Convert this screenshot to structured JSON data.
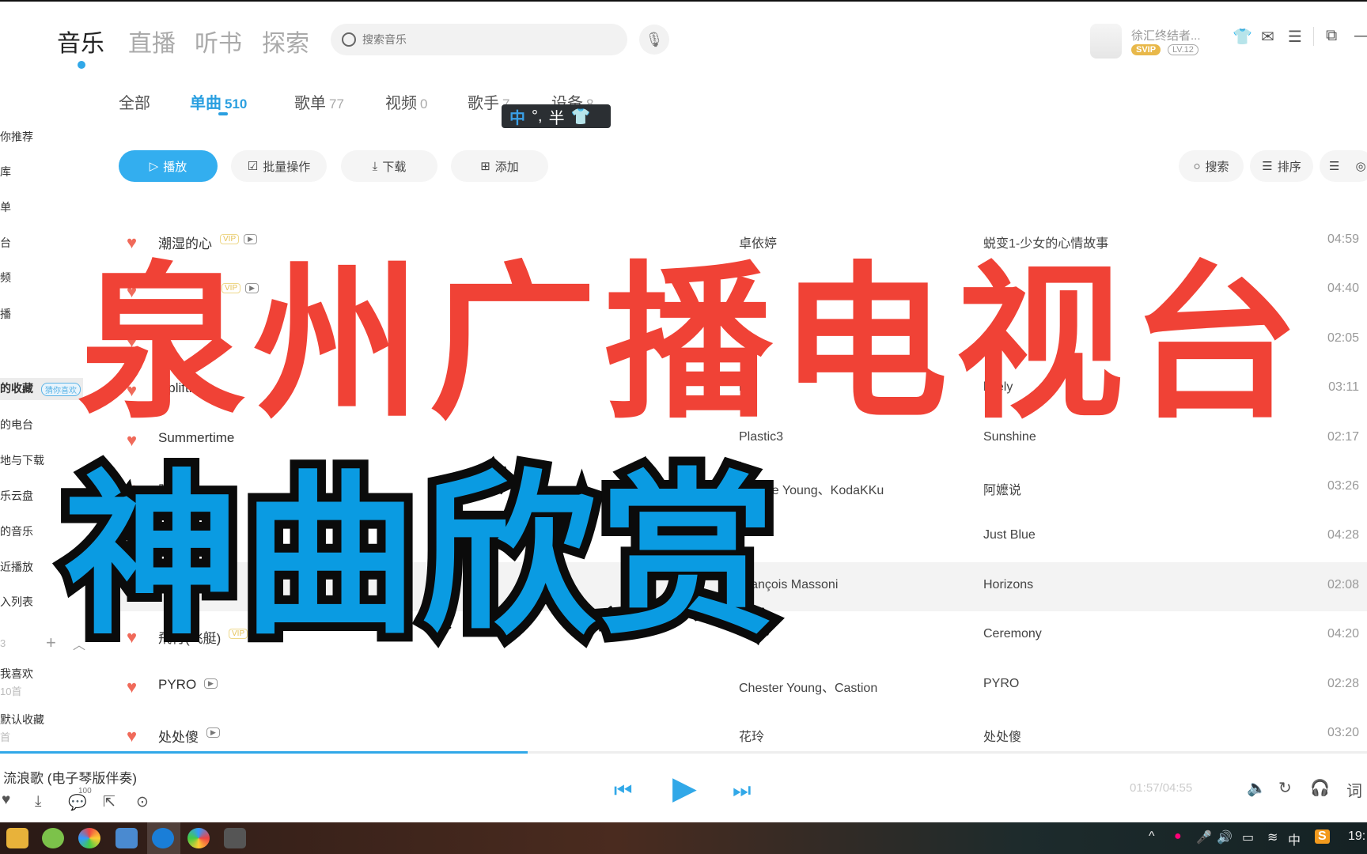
{
  "header": {
    "tabs": [
      "音乐",
      "直播",
      "听书",
      "探索"
    ],
    "active_tab": "音乐",
    "search_placeholder": "搜索音乐",
    "user_name": "徐汇终结者...",
    "svip": "SVIP",
    "level": "LV.12"
  },
  "subtabs": [
    {
      "label": "全部",
      "count": ""
    },
    {
      "label": "单曲",
      "count": "510"
    },
    {
      "label": "歌单",
      "count": "77"
    },
    {
      "label": "视频",
      "count": "0"
    },
    {
      "label": "歌手",
      "count": "7"
    },
    {
      "label": "设备",
      "count": "8"
    }
  ],
  "ime": {
    "mode": "中",
    "punct": "°,",
    "width": "半"
  },
  "toolbar": {
    "play": "播放",
    "batch": "批量操作",
    "download": "下载",
    "add": "添加",
    "search": "搜索",
    "sort": "排序"
  },
  "sidebar": {
    "items": [
      "你推荐",
      "库",
      "单",
      "台",
      "频",
      "播",
      "的收藏",
      "的电台",
      "地与下载",
      "乐云盘",
      "的音乐",
      "近播放",
      "入列表"
    ],
    "guess_badge": "猜你喜欢",
    "playlist_count": "3",
    "playlists": [
      {
        "name": "我喜欢",
        "count": "10首"
      },
      {
        "name": "默认收藏",
        "count": "首"
      }
    ]
  },
  "songs": [
    {
      "title": "潮湿的心",
      "vip": true,
      "mv": true,
      "artist": "卓依婷",
      "album": "蜕变1-少女的心情故事",
      "duration": "04:59"
    },
    {
      "title": "",
      "vip": true,
      "mv": true,
      "artist": "",
      "album": "",
      "duration": "04:40"
    },
    {
      "title": "",
      "vip": false,
      "mv": false,
      "artist": "",
      "album": "",
      "duration": "02:05"
    },
    {
      "title": "Upliftin",
      "vip": false,
      "mv": false,
      "artist": "iur",
      "album": "lutely",
      "duration": "03:11"
    },
    {
      "title": "Summertime",
      "vip": false,
      "mv": false,
      "artist": "Plastic3",
      "album": "Sunshine",
      "duration": "02:17"
    },
    {
      "title": "阿嬷",
      "vip": false,
      "mv": false,
      "artist": "Double Young、KodaKKu",
      "album": "阿嬷说",
      "duration": "03:26"
    },
    {
      "title": "",
      "vip": false,
      "mv": false,
      "artist": "",
      "album": "Just Blue",
      "duration": "04:28"
    },
    {
      "title": "",
      "vip": false,
      "mv": false,
      "artist": "François Massoni",
      "album": "Horizons",
      "duration": "02:08",
      "highlighted": true
    },
    {
      "title": "飛行(飞艇)",
      "vip": true,
      "mv": false,
      "artist": "",
      "album": "Ceremony",
      "duration": "04:20"
    },
    {
      "title": "PYRO",
      "vip": false,
      "mv": true,
      "artist": "Chester Young、Castion",
      "album": "PYRO",
      "duration": "02:28"
    },
    {
      "title": "处处傻",
      "vip": false,
      "mv": true,
      "artist": "花玲",
      "album": "处处傻",
      "duration": "03:20"
    }
  ],
  "vip_tag": "VIP",
  "player": {
    "now_playing": "流浪歌 (电子琴版伴奏)",
    "comment_count": "100",
    "time": "01:57/04:55",
    "progress_percent": 38.6,
    "lyrics": "词"
  },
  "tray": {
    "ime": "中"
  },
  "overlay": {
    "title_red": "泉州广播电视台",
    "title_blue": "神曲欣赏"
  },
  "colors": {
    "accent": "#31a8e8",
    "heart": "#f06a5a",
    "overlay_red": "#f04236",
    "overlay_blue": "#0a9be2"
  }
}
